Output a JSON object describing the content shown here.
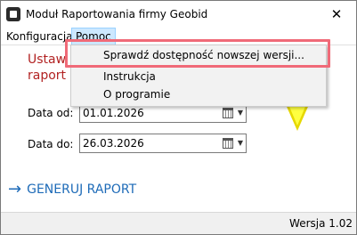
{
  "window": {
    "title": "Moduł Raportowania firmy Geobid",
    "close_label": "✕"
  },
  "menu": {
    "items": [
      {
        "label": "Konfiguracja"
      },
      {
        "label": "Pomoc"
      }
    ]
  },
  "dropdown": {
    "items": [
      {
        "label": "Sprawdź dostępność nowszej wersji..."
      },
      {
        "label": "Instrukcja"
      },
      {
        "label": "O programie"
      }
    ]
  },
  "main": {
    "message_line1": "Ustaw d",
    "message_line2": "raport K",
    "date_from": {
      "label": "Data od:",
      "value": "01.01.2026"
    },
    "date_to": {
      "label": "Data do:",
      "value": "26.03.2026"
    },
    "generate": {
      "arrow": "→",
      "label": "GENERUJ RAPORT"
    }
  },
  "status": {
    "version": "Wersja 1.02"
  },
  "colors": {
    "accent_blue": "#1e6bb8",
    "error_red": "#b22222",
    "highlight": "#f06a78",
    "warning_yellow": "#ffff40"
  }
}
